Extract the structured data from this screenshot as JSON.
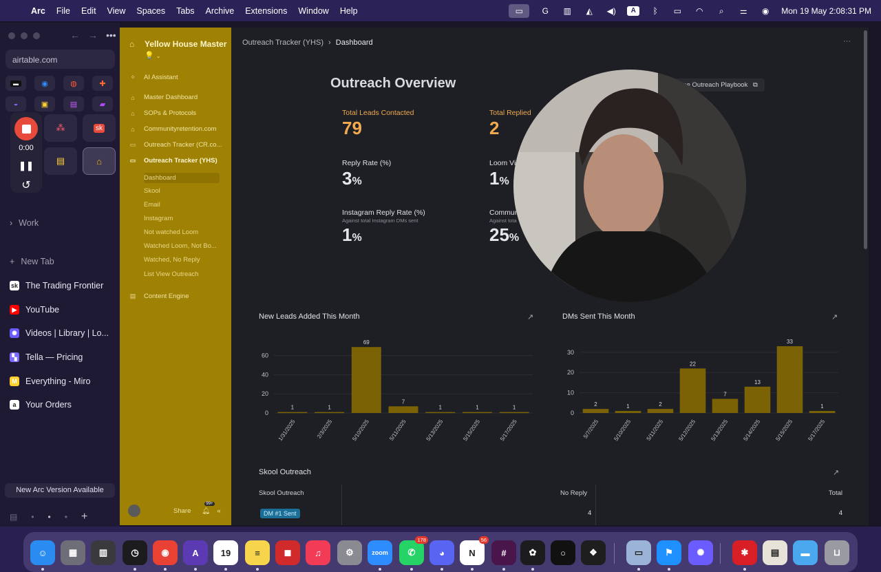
{
  "menubar": {
    "app": "Arc",
    "items": [
      "File",
      "Edit",
      "View",
      "Spaces",
      "Tabs",
      "Archive",
      "Extensions",
      "Window",
      "Help"
    ],
    "datetime": "Mon 19 May  2:08:31 PM"
  },
  "arc": {
    "url": "airtable.com",
    "recorder": {
      "time": "0:00"
    },
    "folder": "Work",
    "new_tab": "New Tab",
    "tabs": [
      {
        "label": "The Trading Frontier",
        "icon": "sk",
        "color": "#ffffff"
      },
      {
        "label": "YouTube",
        "icon": "▶",
        "color": "#ff0000"
      },
      {
        "label": "Videos | Library | Lo...",
        "icon": "✺",
        "color": "#6a5cff"
      },
      {
        "label": "Tella — Pricing",
        "icon": "▚",
        "color": "#7b6cff"
      },
      {
        "label": "Everything - Miro",
        "icon": "M",
        "color": "#ffd02f"
      },
      {
        "label": "Your Orders",
        "icon": "a",
        "color": "#ffffff"
      }
    ],
    "update_banner": "New Arc Version Available"
  },
  "airtable_nav": {
    "title": "Yellow House Master",
    "emoji": "💡",
    "items": [
      {
        "label": "AI Assistant",
        "icon": "✧",
        "level": 0
      },
      {
        "label": "Master Dashboard",
        "icon": "⌂",
        "level": 0
      },
      {
        "label": "SOPs & Protocols",
        "icon": "⌂",
        "level": 0
      },
      {
        "label": "Communityretention.com",
        "icon": "⌂",
        "level": 0
      },
      {
        "label": "Outreach Tracker (CR.co...",
        "icon": "▭",
        "level": 0
      },
      {
        "label": "Outreach Tracker (YHS)",
        "icon": "▭",
        "level": 0,
        "bold": true
      },
      {
        "label": "Dashboard",
        "level": 1,
        "active": true
      },
      {
        "label": "Skool",
        "level": 1
      },
      {
        "label": "Email",
        "level": 1
      },
      {
        "label": "Instagram",
        "level": 1
      },
      {
        "label": "Not watched Loom",
        "level": 1
      },
      {
        "label": "Watched Loom, Not Bo...",
        "level": 1
      },
      {
        "label": "Watched, No Reply",
        "level": 1
      },
      {
        "label": "List View Outreach",
        "level": 1
      },
      {
        "label": "Content Engine",
        "icon": "▤",
        "level": 0
      }
    ],
    "share": "Share",
    "notif_badge": "99+"
  },
  "dashboard": {
    "breadcrumb": {
      "parent": "Outreach Tracker (YHS)",
      "current": "Dashboard"
    },
    "title": "Outreach Overview",
    "playbook": "See Outreach Playbook",
    "metrics": [
      {
        "label": "Total Leads Contacted",
        "value": "79",
        "unit": "",
        "highlight": true
      },
      {
        "label": "Total Replied",
        "value": "2",
        "unit": "",
        "highlight": true
      },
      {
        "label": "Reply Rate (%)",
        "value": "3",
        "unit": "%"
      },
      {
        "label": "Loom Vi",
        "value": "1",
        "unit": "%"
      },
      {
        "label": "Instagram Reply Rate (%)",
        "sub": "Against total Instagram DMs sent",
        "value": "1",
        "unit": "%"
      },
      {
        "label": "Commun",
        "sub": "Against tota",
        "value": "25",
        "unit": "%"
      }
    ],
    "table": {
      "title": "Skool Outreach",
      "columns": [
        "Skool Outreach",
        "No Reply",
        "Total"
      ],
      "rows": [
        {
          "tag": "DM #1 Sent",
          "no_reply": "4",
          "total": "4"
        }
      ]
    }
  },
  "chart_data": [
    {
      "type": "bar",
      "title": "New Leads Added This Month",
      "categories": [
        "1/31/2025",
        "2/3/2025",
        "5/10/2025",
        "5/11/2025",
        "5/13/2025",
        "5/15/2025",
        "5/17/2025"
      ],
      "values": [
        1,
        1,
        69,
        7,
        1,
        1,
        1
      ],
      "yticks": [
        0,
        20,
        40,
        60
      ],
      "ylim": [
        0,
        72
      ],
      "color": "#7a6205"
    },
    {
      "type": "bar",
      "title": "DMs Sent This Month",
      "categories": [
        "5/7/2025",
        "5/10/2025",
        "5/11/2025",
        "5/12/2025",
        "5/13/2025",
        "5/14/2025",
        "5/15/2025",
        "5/17/2025"
      ],
      "values": [
        2,
        1,
        2,
        22,
        7,
        13,
        33,
        1
      ],
      "yticks": [
        0,
        10,
        20,
        30
      ],
      "ylim": [
        0,
        34
      ],
      "color": "#7a6205"
    }
  ],
  "dock": [
    {
      "name": "finder",
      "label": "☺",
      "color": "#2a8cf0"
    },
    {
      "name": "launchpad",
      "label": "▦",
      "color": "#6e6e78"
    },
    {
      "name": "calculator",
      "label": "▥",
      "color": "#3a3a3e"
    },
    {
      "name": "clock",
      "label": "◷",
      "color": "#1c1c1e"
    },
    {
      "name": "chrome",
      "label": "◉",
      "color": "#e94235"
    },
    {
      "name": "affinity",
      "label": "A",
      "color": "#5b3ab3"
    },
    {
      "name": "calendar",
      "label": "19",
      "color": "#ffffff"
    },
    {
      "name": "notes",
      "label": "≡",
      "color": "#f6d44b"
    },
    {
      "name": "photo-booth",
      "label": "◼",
      "color": "#d12a2a"
    },
    {
      "name": "music",
      "label": "♫",
      "color": "#f23b55"
    },
    {
      "name": "system-settings",
      "label": "⚙",
      "color": "#8a8a92"
    },
    {
      "name": "zoom",
      "label": "zoom",
      "color": "#2d8cff"
    },
    {
      "name": "whatsapp",
      "label": "✆",
      "color": "#25d366",
      "badge": "178"
    },
    {
      "name": "discord",
      "label": "◕",
      "color": "#5865f2"
    },
    {
      "name": "notion",
      "label": "N",
      "color": "#ffffff",
      "badge": "56"
    },
    {
      "name": "slack",
      "label": "#",
      "color": "#4a154b"
    },
    {
      "name": "chatgpt",
      "label": "✿",
      "color": "#1c1c1e"
    },
    {
      "name": "circle-app",
      "label": "○",
      "color": "#111111"
    },
    {
      "name": "figma",
      "label": "❖",
      "color": "#1e1e1e"
    },
    {
      "name": "preview",
      "label": "▭",
      "color": "#9ab3d6"
    },
    {
      "name": "framer",
      "label": "⚑",
      "color": "#1e90ff"
    },
    {
      "name": "perplexity",
      "label": "✺",
      "color": "#6a5cff"
    },
    {
      "name": "acrobat",
      "label": "✱",
      "color": "#d81f26"
    },
    {
      "name": "archive",
      "label": "▤",
      "color": "#e8e3d8"
    },
    {
      "name": "downloads-folder",
      "label": "▬",
      "color": "#4aa8ee"
    },
    {
      "name": "trash",
      "label": "⊔",
      "color": "#9a9aa2"
    }
  ]
}
